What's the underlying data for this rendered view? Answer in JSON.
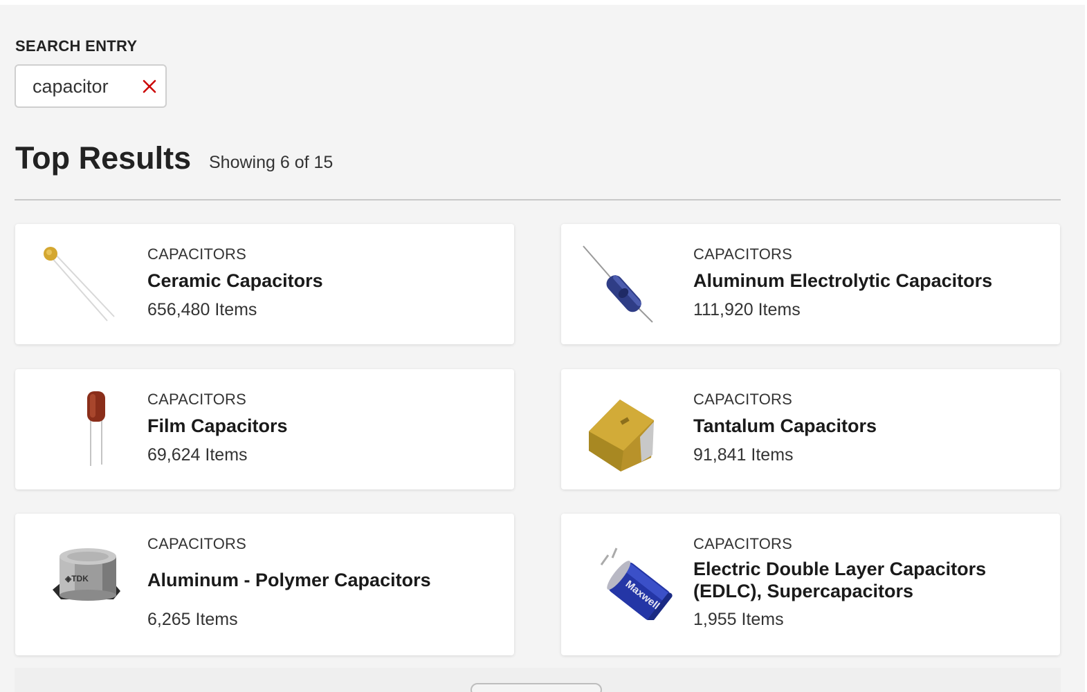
{
  "search": {
    "label": "SEARCH ENTRY",
    "value": "capacitor",
    "clear_icon": "close-icon",
    "clear_color": "#cc0000"
  },
  "results": {
    "title": "Top Results",
    "count_text": "Showing 6 of 15"
  },
  "cards": [
    {
      "category": "CAPACITORS",
      "name": "Ceramic Capacitors",
      "count": "656,480 Items",
      "icon": "ceramic-capacitor-image"
    },
    {
      "category": "CAPACITORS",
      "name": "Aluminum Electrolytic Capacitors",
      "count": "111,920 Items",
      "icon": "electrolytic-capacitor-image"
    },
    {
      "category": "CAPACITORS",
      "name": "Film Capacitors",
      "count": "69,624 Items",
      "icon": "film-capacitor-image"
    },
    {
      "category": "CAPACITORS",
      "name": "Tantalum Capacitors",
      "count": "91,841 Items",
      "icon": "tantalum-capacitor-image"
    },
    {
      "category": "CAPACITORS",
      "name": "Aluminum - Polymer Capacitors",
      "count": "6,265 Items",
      "icon": "polymer-capacitor-image",
      "brand": "TDK"
    },
    {
      "category": "CAPACITORS",
      "name": "Electric Double Layer Capacitors (EDLC), Supercapacitors",
      "count": "1,955 Items",
      "icon": "supercapacitor-image",
      "brand": "Maxwell"
    }
  ]
}
